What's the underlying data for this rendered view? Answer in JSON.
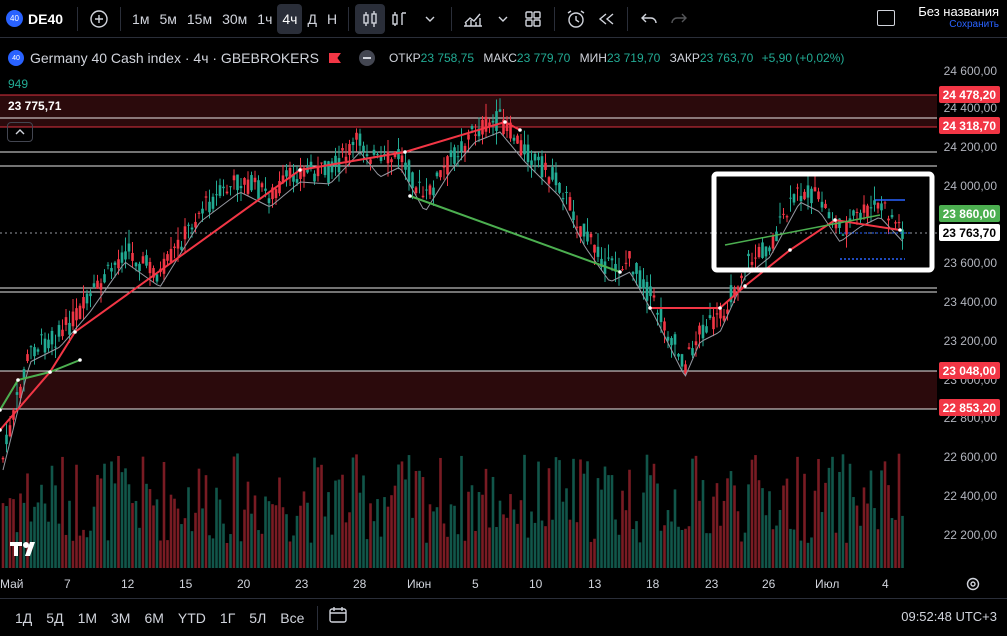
{
  "toolbar": {
    "symbol": "DE40",
    "symbol_logo": "40",
    "timeframes": [
      "1м",
      "5м",
      "15м",
      "30м",
      "1ч",
      "4ч",
      "Д",
      "Н"
    ],
    "active_timeframe": "4ч",
    "layout_name": "Без названия",
    "layout_save": "Сохранить",
    "icons": [
      "plus-circle-icon",
      "candles-icon",
      "indicator-icon",
      "chevron-down-icon",
      "chart-type-icon",
      "templates-icon",
      "alert-icon",
      "replay-icon",
      "undo-icon",
      "redo-icon",
      "fullscreen-icon"
    ]
  },
  "legend": {
    "title": "Germany 40 Cash index · 4ч · GBEBROKERS",
    "logo": "40",
    "ohlc": [
      {
        "k": "ОТКР",
        "v": "23 758,75"
      },
      {
        "k": "МАКС",
        "v": "23 779,70"
      },
      {
        "k": "МИН",
        "v": "23 719,70"
      },
      {
        "k": "ЗАКР",
        "v": "23 763,70"
      }
    ],
    "change": "+5,90 (+0,02%)",
    "volume": "949",
    "price": "23 775,71"
  },
  "price_axis": {
    "labels": [
      "24 600,00",
      "24 400,00",
      "24 200,00",
      "24 000,00",
      "23 600,00",
      "23 400,00",
      "23 200,00",
      "23 000,00",
      "22 800,00",
      "22 600,00",
      "22 400,00",
      "22 200,00"
    ],
    "tags": [
      {
        "text": "24 478,20",
        "color": "#f23645"
      },
      {
        "text": "24 318,70",
        "color": "#f23645"
      },
      {
        "text": "23 860,00",
        "color": "#4caf50"
      },
      {
        "text": "23 763,70",
        "color": "#ffffff"
      },
      {
        "text": "23 048,00",
        "color": "#f23645"
      },
      {
        "text": "22 853,20",
        "color": "#f23645"
      }
    ]
  },
  "time_axis": [
    "Май",
    "7",
    "12",
    "15",
    "20",
    "23",
    "28",
    "Июн",
    "5",
    "10",
    "13",
    "18",
    "23",
    "26",
    "Июл",
    "4"
  ],
  "bottom": {
    "ranges": [
      "1Д",
      "5Д",
      "1М",
      "3М",
      "6М",
      "YTD",
      "1Г",
      "5Л",
      "Все"
    ],
    "clock": "09:52:48 UTC+3"
  },
  "colors": {
    "up": "#22ab94",
    "down": "#f23645",
    "background": "#000000",
    "accent": "#2962ff"
  }
}
